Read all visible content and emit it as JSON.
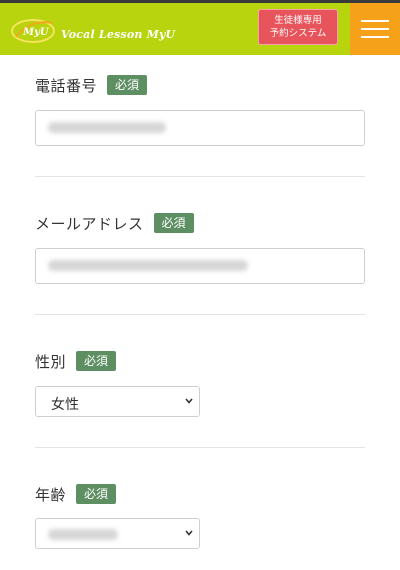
{
  "header": {
    "logo_text": "MyU",
    "brand": "Vocal Lesson MyU",
    "reserve_button_line1": "生徒様専用",
    "reserve_button_line2": "予約システム",
    "accent_color": "#b7d40f",
    "menu_color": "#f6a11a"
  },
  "form": {
    "required_badge": "必須",
    "phone": {
      "label": "電話番号",
      "value": ""
    },
    "email": {
      "label": "メールアドレス",
      "value": ""
    },
    "gender": {
      "label": "性別",
      "selected": "女性"
    },
    "age": {
      "label": "年齢",
      "selected": ""
    }
  }
}
